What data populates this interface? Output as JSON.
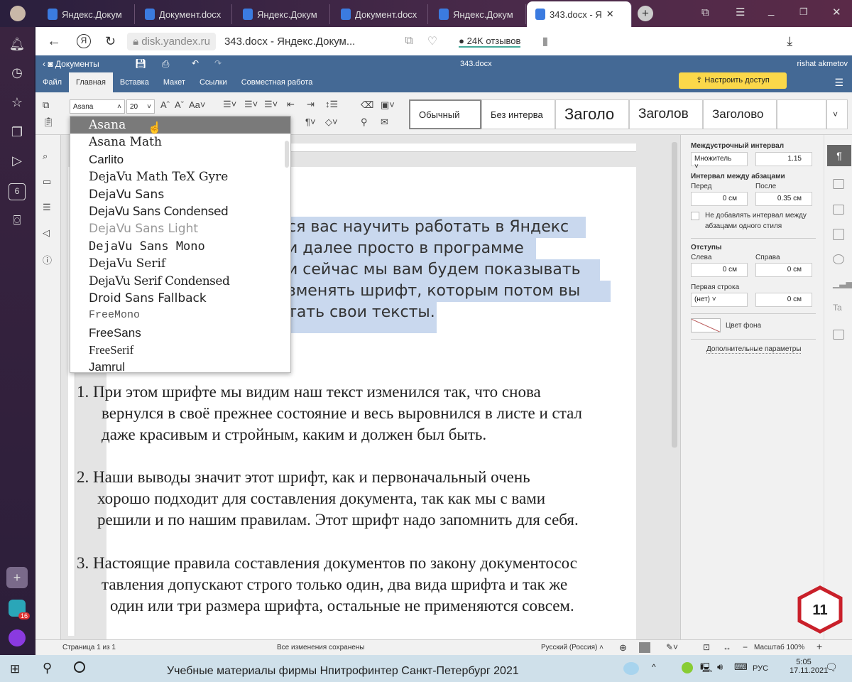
{
  "browser": {
    "tabs": [
      {
        "label": "Яндекс.Докум"
      },
      {
        "label": "Документ.docx"
      },
      {
        "label": "Яндекс.Докум"
      },
      {
        "label": "Документ.docx"
      },
      {
        "label": "Яндекс.Докум"
      },
      {
        "label": "343.docx - Я"
      }
    ],
    "domain": "disk.yandex.ru",
    "page_title": "343.docx - Яндекс.Докум...",
    "reviews": "24K отзывов",
    "side_badge": "6",
    "side_count": "16"
  },
  "app": {
    "brand": "Документы",
    "filename": "343.docx",
    "user": "rishat akmetov",
    "menu": [
      "Файл",
      "Главная",
      "Вставка",
      "Макет",
      "Ссылки",
      "Совместная работа"
    ],
    "share_button": "Настроить доступ"
  },
  "toolbar": {
    "font": "Asana",
    "size": "20",
    "styles": [
      "Обычный",
      "Без интерва",
      "Заголо",
      "Заголов",
      "Заголово"
    ]
  },
  "font_list": {
    "items": [
      "Asana",
      "Asana Math",
      "Carlito",
      "DejaVu Math TeX Gyre",
      "DejaVu Sans",
      "DejaVu Sans Condensed",
      "DejaVu Sans Light",
      "DejaVu Sans Mono",
      "DejaVu Serif",
      "DejaVu Serif Condensed",
      "Droid Sans Fallback",
      "FreeMono",
      "FreeSans",
      "FreeSerif",
      "Jamrul"
    ],
    "selected": "Asana"
  },
  "document": {
    "selected_lines": [
      "ся вас научить работать в Яндекс",
      "и далее просто в программе",
      "и сейчас мы вам будем показывать",
      "зменять шрифт, которым потом вы",
      "тать свои тексты."
    ],
    "list": [
      [
        "1. При этом шрифте мы видим наш текст изменился так, что снова",
        "вернулся в своё прежнее состояние и весь выровнился в листе и стал",
        "даже красивым и стройным, каким и должен был быть."
      ],
      [
        "2. Наши выводы значит этот шрифт, как и первоначальный очень",
        "хорошо подходит для составления документа, так как мы с вами",
        "решили и по нашим правилам. Этот шрифт надо запомнить для себя."
      ],
      [
        "3. Настоящие правила составления документов по закону документосос",
        "тавления допускают строго только один, два вида шрифта и так же",
        "один или три размера шрифта, остальные не применяются совсем."
      ]
    ]
  },
  "panel": {
    "line_spacing_title": "Междустрочный интервал",
    "line_spacing_type": "Множитель",
    "line_spacing_value": "1.15",
    "para_spacing_title": "Интервал между абзацами",
    "before_label": "Перед",
    "before": "0 см",
    "after_label": "После",
    "after": "0.35 см",
    "no_space_label_1": "Не добавлять интервал между",
    "no_space_label_2": "абзацами одного стиля",
    "indents_title": "Отступы",
    "left_label": "Слева",
    "left": "0 см",
    "right_label": "Справа",
    "right": "0 см",
    "first_line_label": "Первая строка",
    "first_line_type": "(нет)",
    "first_line": "0 см",
    "bg_color_label": "Цвет фона",
    "advanced_link": "Дополнительные параметры"
  },
  "status": {
    "page": "Страница 1 из 1",
    "saved": "Все изменения сохранены",
    "language": "Русский (Россия)",
    "zoom": "Масштаб 100%"
  },
  "taskbar": {
    "caption": "Учебные материалы фирмы Нпитрофинтер Санкт-Петербург 2021",
    "lang": "РУС",
    "time": "5:05",
    "date": "17.11.2021"
  },
  "badge": "11"
}
